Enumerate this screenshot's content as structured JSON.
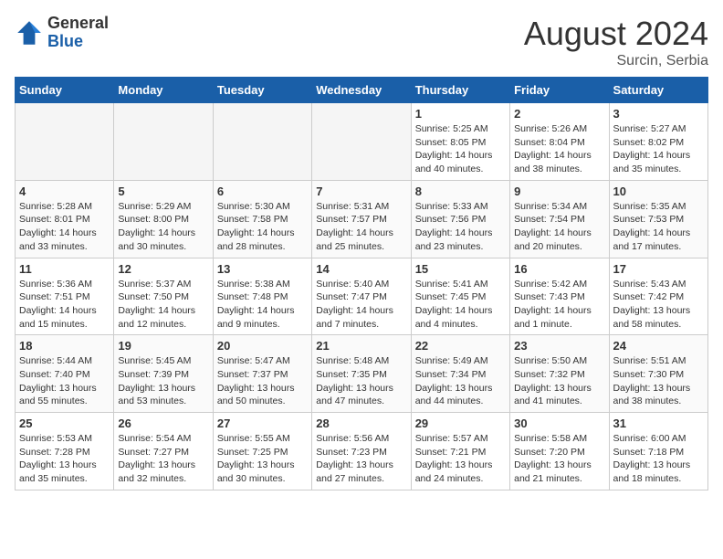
{
  "header": {
    "logo_general": "General",
    "logo_blue": "Blue",
    "month_year": "August 2024",
    "location": "Surcin, Serbia"
  },
  "weekdays": [
    "Sunday",
    "Monday",
    "Tuesday",
    "Wednesday",
    "Thursday",
    "Friday",
    "Saturday"
  ],
  "weeks": [
    [
      {
        "day": "",
        "sunrise": "",
        "sunset": "",
        "daylight": ""
      },
      {
        "day": "",
        "sunrise": "",
        "sunset": "",
        "daylight": ""
      },
      {
        "day": "",
        "sunrise": "",
        "sunset": "",
        "daylight": ""
      },
      {
        "day": "",
        "sunrise": "",
        "sunset": "",
        "daylight": ""
      },
      {
        "day": "1",
        "sunrise": "5:25 AM",
        "sunset": "8:05 PM",
        "daylight": "14 hours and 40 minutes."
      },
      {
        "day": "2",
        "sunrise": "5:26 AM",
        "sunset": "8:04 PM",
        "daylight": "14 hours and 38 minutes."
      },
      {
        "day": "3",
        "sunrise": "5:27 AM",
        "sunset": "8:02 PM",
        "daylight": "14 hours and 35 minutes."
      }
    ],
    [
      {
        "day": "4",
        "sunrise": "5:28 AM",
        "sunset": "8:01 PM",
        "daylight": "14 hours and 33 minutes."
      },
      {
        "day": "5",
        "sunrise": "5:29 AM",
        "sunset": "8:00 PM",
        "daylight": "14 hours and 30 minutes."
      },
      {
        "day": "6",
        "sunrise": "5:30 AM",
        "sunset": "7:58 PM",
        "daylight": "14 hours and 28 minutes."
      },
      {
        "day": "7",
        "sunrise": "5:31 AM",
        "sunset": "7:57 PM",
        "daylight": "14 hours and 25 minutes."
      },
      {
        "day": "8",
        "sunrise": "5:33 AM",
        "sunset": "7:56 PM",
        "daylight": "14 hours and 23 minutes."
      },
      {
        "day": "9",
        "sunrise": "5:34 AM",
        "sunset": "7:54 PM",
        "daylight": "14 hours and 20 minutes."
      },
      {
        "day": "10",
        "sunrise": "5:35 AM",
        "sunset": "7:53 PM",
        "daylight": "14 hours and 17 minutes."
      }
    ],
    [
      {
        "day": "11",
        "sunrise": "5:36 AM",
        "sunset": "7:51 PM",
        "daylight": "14 hours and 15 minutes."
      },
      {
        "day": "12",
        "sunrise": "5:37 AM",
        "sunset": "7:50 PM",
        "daylight": "14 hours and 12 minutes."
      },
      {
        "day": "13",
        "sunrise": "5:38 AM",
        "sunset": "7:48 PM",
        "daylight": "14 hours and 9 minutes."
      },
      {
        "day": "14",
        "sunrise": "5:40 AM",
        "sunset": "7:47 PM",
        "daylight": "14 hours and 7 minutes."
      },
      {
        "day": "15",
        "sunrise": "5:41 AM",
        "sunset": "7:45 PM",
        "daylight": "14 hours and 4 minutes."
      },
      {
        "day": "16",
        "sunrise": "5:42 AM",
        "sunset": "7:43 PM",
        "daylight": "14 hours and 1 minute."
      },
      {
        "day": "17",
        "sunrise": "5:43 AM",
        "sunset": "7:42 PM",
        "daylight": "13 hours and 58 minutes."
      }
    ],
    [
      {
        "day": "18",
        "sunrise": "5:44 AM",
        "sunset": "7:40 PM",
        "daylight": "13 hours and 55 minutes."
      },
      {
        "day": "19",
        "sunrise": "5:45 AM",
        "sunset": "7:39 PM",
        "daylight": "13 hours and 53 minutes."
      },
      {
        "day": "20",
        "sunrise": "5:47 AM",
        "sunset": "7:37 PM",
        "daylight": "13 hours and 50 minutes."
      },
      {
        "day": "21",
        "sunrise": "5:48 AM",
        "sunset": "7:35 PM",
        "daylight": "13 hours and 47 minutes."
      },
      {
        "day": "22",
        "sunrise": "5:49 AM",
        "sunset": "7:34 PM",
        "daylight": "13 hours and 44 minutes."
      },
      {
        "day": "23",
        "sunrise": "5:50 AM",
        "sunset": "7:32 PM",
        "daylight": "13 hours and 41 minutes."
      },
      {
        "day": "24",
        "sunrise": "5:51 AM",
        "sunset": "7:30 PM",
        "daylight": "13 hours and 38 minutes."
      }
    ],
    [
      {
        "day": "25",
        "sunrise": "5:53 AM",
        "sunset": "7:28 PM",
        "daylight": "13 hours and 35 minutes."
      },
      {
        "day": "26",
        "sunrise": "5:54 AM",
        "sunset": "7:27 PM",
        "daylight": "13 hours and 32 minutes."
      },
      {
        "day": "27",
        "sunrise": "5:55 AM",
        "sunset": "7:25 PM",
        "daylight": "13 hours and 30 minutes."
      },
      {
        "day": "28",
        "sunrise": "5:56 AM",
        "sunset": "7:23 PM",
        "daylight": "13 hours and 27 minutes."
      },
      {
        "day": "29",
        "sunrise": "5:57 AM",
        "sunset": "7:21 PM",
        "daylight": "13 hours and 24 minutes."
      },
      {
        "day": "30",
        "sunrise": "5:58 AM",
        "sunset": "7:20 PM",
        "daylight": "13 hours and 21 minutes."
      },
      {
        "day": "31",
        "sunrise": "6:00 AM",
        "sunset": "7:18 PM",
        "daylight": "13 hours and 18 minutes."
      }
    ]
  ]
}
